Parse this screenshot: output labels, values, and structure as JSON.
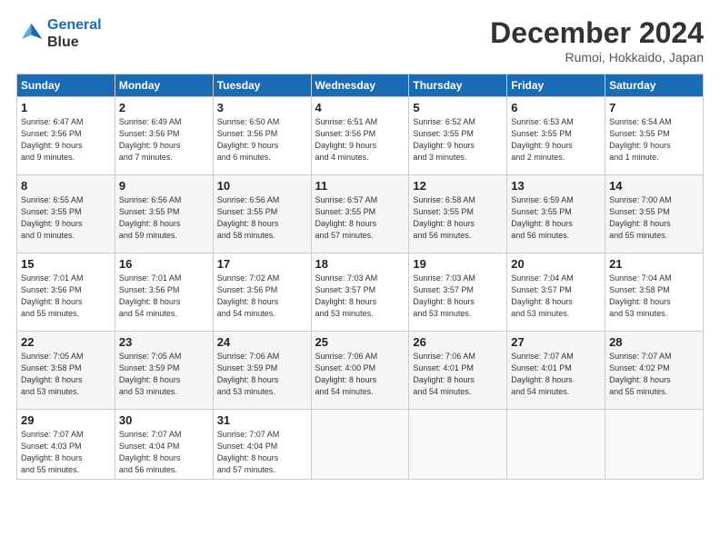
{
  "header": {
    "logo_line1": "General",
    "logo_line2": "Blue",
    "month": "December 2024",
    "location": "Rumoi, Hokkaido, Japan"
  },
  "weekdays": [
    "Sunday",
    "Monday",
    "Tuesday",
    "Wednesday",
    "Thursday",
    "Friday",
    "Saturday"
  ],
  "weeks": [
    [
      {
        "day": "1",
        "info": "Sunrise: 6:47 AM\nSunset: 3:56 PM\nDaylight: 9 hours\nand 9 minutes."
      },
      {
        "day": "2",
        "info": "Sunrise: 6:49 AM\nSunset: 3:56 PM\nDaylight: 9 hours\nand 7 minutes."
      },
      {
        "day": "3",
        "info": "Sunrise: 6:50 AM\nSunset: 3:56 PM\nDaylight: 9 hours\nand 6 minutes."
      },
      {
        "day": "4",
        "info": "Sunrise: 6:51 AM\nSunset: 3:56 PM\nDaylight: 9 hours\nand 4 minutes."
      },
      {
        "day": "5",
        "info": "Sunrise: 6:52 AM\nSunset: 3:55 PM\nDaylight: 9 hours\nand 3 minutes."
      },
      {
        "day": "6",
        "info": "Sunrise: 6:53 AM\nSunset: 3:55 PM\nDaylight: 9 hours\nand 2 minutes."
      },
      {
        "day": "7",
        "info": "Sunrise: 6:54 AM\nSunset: 3:55 PM\nDaylight: 9 hours\nand 1 minute."
      }
    ],
    [
      {
        "day": "8",
        "info": "Sunrise: 6:55 AM\nSunset: 3:55 PM\nDaylight: 9 hours\nand 0 minutes."
      },
      {
        "day": "9",
        "info": "Sunrise: 6:56 AM\nSunset: 3:55 PM\nDaylight: 8 hours\nand 59 minutes."
      },
      {
        "day": "10",
        "info": "Sunrise: 6:56 AM\nSunset: 3:55 PM\nDaylight: 8 hours\nand 58 minutes."
      },
      {
        "day": "11",
        "info": "Sunrise: 6:57 AM\nSunset: 3:55 PM\nDaylight: 8 hours\nand 57 minutes."
      },
      {
        "day": "12",
        "info": "Sunrise: 6:58 AM\nSunset: 3:55 PM\nDaylight: 8 hours\nand 56 minutes."
      },
      {
        "day": "13",
        "info": "Sunrise: 6:59 AM\nSunset: 3:55 PM\nDaylight: 8 hours\nand 56 minutes."
      },
      {
        "day": "14",
        "info": "Sunrise: 7:00 AM\nSunset: 3:55 PM\nDaylight: 8 hours\nand 55 minutes."
      }
    ],
    [
      {
        "day": "15",
        "info": "Sunrise: 7:01 AM\nSunset: 3:56 PM\nDaylight: 8 hours\nand 55 minutes."
      },
      {
        "day": "16",
        "info": "Sunrise: 7:01 AM\nSunset: 3:56 PM\nDaylight: 8 hours\nand 54 minutes."
      },
      {
        "day": "17",
        "info": "Sunrise: 7:02 AM\nSunset: 3:56 PM\nDaylight: 8 hours\nand 54 minutes."
      },
      {
        "day": "18",
        "info": "Sunrise: 7:03 AM\nSunset: 3:57 PM\nDaylight: 8 hours\nand 53 minutes."
      },
      {
        "day": "19",
        "info": "Sunrise: 7:03 AM\nSunset: 3:57 PM\nDaylight: 8 hours\nand 53 minutes."
      },
      {
        "day": "20",
        "info": "Sunrise: 7:04 AM\nSunset: 3:57 PM\nDaylight: 8 hours\nand 53 minutes."
      },
      {
        "day": "21",
        "info": "Sunrise: 7:04 AM\nSunset: 3:58 PM\nDaylight: 8 hours\nand 53 minutes."
      }
    ],
    [
      {
        "day": "22",
        "info": "Sunrise: 7:05 AM\nSunset: 3:58 PM\nDaylight: 8 hours\nand 53 minutes."
      },
      {
        "day": "23",
        "info": "Sunrise: 7:05 AM\nSunset: 3:59 PM\nDaylight: 8 hours\nand 53 minutes."
      },
      {
        "day": "24",
        "info": "Sunrise: 7:06 AM\nSunset: 3:59 PM\nDaylight: 8 hours\nand 53 minutes."
      },
      {
        "day": "25",
        "info": "Sunrise: 7:06 AM\nSunset: 4:00 PM\nDaylight: 8 hours\nand 54 minutes."
      },
      {
        "day": "26",
        "info": "Sunrise: 7:06 AM\nSunset: 4:01 PM\nDaylight: 8 hours\nand 54 minutes."
      },
      {
        "day": "27",
        "info": "Sunrise: 7:07 AM\nSunset: 4:01 PM\nDaylight: 8 hours\nand 54 minutes."
      },
      {
        "day": "28",
        "info": "Sunrise: 7:07 AM\nSunset: 4:02 PM\nDaylight: 8 hours\nand 55 minutes."
      }
    ],
    [
      {
        "day": "29",
        "info": "Sunrise: 7:07 AM\nSunset: 4:03 PM\nDaylight: 8 hours\nand 55 minutes."
      },
      {
        "day": "30",
        "info": "Sunrise: 7:07 AM\nSunset: 4:04 PM\nDaylight: 8 hours\nand 56 minutes."
      },
      {
        "day": "31",
        "info": "Sunrise: 7:07 AM\nSunset: 4:04 PM\nDaylight: 8 hours\nand 57 minutes."
      },
      null,
      null,
      null,
      null
    ]
  ]
}
